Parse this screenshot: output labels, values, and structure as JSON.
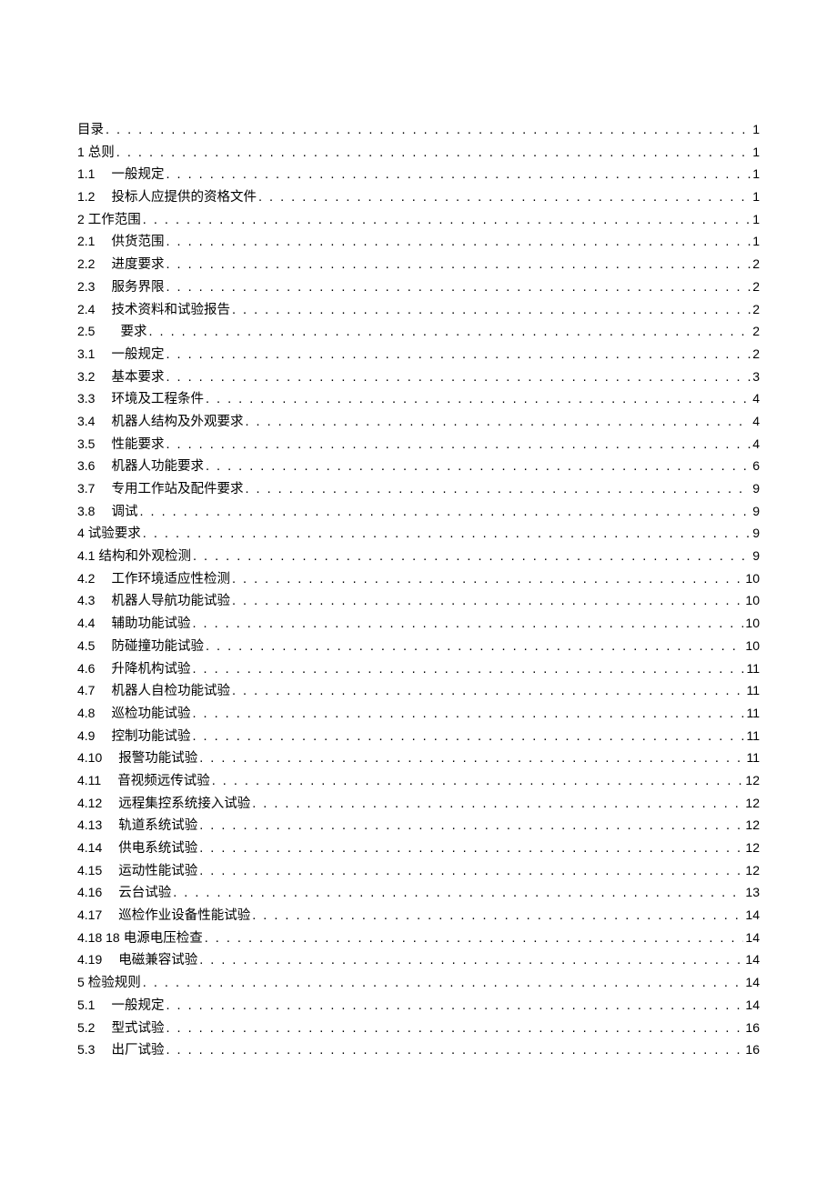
{
  "toc": [
    {
      "num": "",
      "title": "目录",
      "page": "1",
      "indent": 0
    },
    {
      "num": "1",
      "title": "总则",
      "page": "1",
      "indent": 0
    },
    {
      "num": "1.1",
      "title": "一般规定",
      "page": "1",
      "indent": 1
    },
    {
      "num": "1.2",
      "title": "投标人应提供的资格文件",
      "page": "1",
      "indent": 1
    },
    {
      "num": "2",
      "title": "工作范围",
      "page": "1",
      "indent": 0
    },
    {
      "num": "2.1",
      "title": "供货范围",
      "page": "1",
      "indent": 1
    },
    {
      "num": "2.2",
      "title": "进度要求",
      "page": "2",
      "indent": 1
    },
    {
      "num": "2.3",
      "title": "服务界限",
      "page": "2",
      "indent": 1
    },
    {
      "num": "2.4",
      "title": "技术资料和试验报告",
      "page": "2",
      "indent": 1
    },
    {
      "num": "2.5",
      "title": "要求",
      "page": "2",
      "indent": 1,
      "special": true
    },
    {
      "num": "3.1",
      "title": "一般规定",
      "page": "2",
      "indent": 1
    },
    {
      "num": "3.2",
      "title": "基本要求",
      "page": "3",
      "indent": 1
    },
    {
      "num": "3.3",
      "title": "环境及工程条件",
      "page": "4",
      "indent": 1
    },
    {
      "num": "3.4",
      "title": "机器人结构及外观要求",
      "page": "4",
      "indent": 1
    },
    {
      "num": "3.5",
      "title": "性能要求",
      "page": "4",
      "indent": 1
    },
    {
      "num": "3.6",
      "title": "机器人功能要求",
      "page": "6",
      "indent": 1
    },
    {
      "num": "3.7",
      "title": "专用工作站及配件要求",
      "page": "9",
      "indent": 1
    },
    {
      "num": "3.8",
      "title": "调试",
      "page": "9",
      "indent": 1
    },
    {
      "num": "4",
      "title": "试验要求",
      "page": "9",
      "indent": 0
    },
    {
      "num": "4.1",
      "title": "结构和外观检测",
      "page": "9",
      "indent": 0
    },
    {
      "num": "4.2",
      "title": "工作环境适应性检测",
      "page": "10",
      "indent": 1
    },
    {
      "num": "4.3",
      "title": "机器人导航功能试验",
      "page": "10",
      "indent": 1
    },
    {
      "num": "4.4",
      "title": "辅助功能试验",
      "page": "10",
      "indent": 1
    },
    {
      "num": "4.5",
      "title": "防碰撞功能试验",
      "page": "10",
      "indent": 1
    },
    {
      "num": "4.6",
      "title": "升降机构试验",
      "page": "11",
      "indent": 1
    },
    {
      "num": "4.7",
      "title": "机器人自检功能试验",
      "page": "11",
      "indent": 1
    },
    {
      "num": "4.8",
      "title": "巡检功能试验",
      "page": "11",
      "indent": 1
    },
    {
      "num": "4.9",
      "title": "控制功能试验",
      "page": "11",
      "indent": 1
    },
    {
      "num": "4.10",
      "title": "报警功能试验",
      "page": "11",
      "indent": 2
    },
    {
      "num": "4.11",
      "title": "音视频远传试验",
      "page": "12",
      "indent": 2
    },
    {
      "num": "4.12",
      "title": "远程集控系统接入试验",
      "page": "12",
      "indent": 2
    },
    {
      "num": "4.13",
      "title": "轨道系统试验",
      "page": "12",
      "indent": 2
    },
    {
      "num": "4.14",
      "title": "供电系统试验",
      "page": "12",
      "indent": 2
    },
    {
      "num": "4.15",
      "title": "运动性能试验",
      "page": "12",
      "indent": 2
    },
    {
      "num": "4.16",
      "title": "云台试验",
      "page": "13",
      "indent": 2
    },
    {
      "num": "4.17",
      "title": "巡检作业设备性能试验",
      "page": "14",
      "indent": 2
    },
    {
      "num": "4.18 18",
      "title": "电源电压检查",
      "page": "14",
      "indent": 0
    },
    {
      "num": "4.19",
      "title": "电磁兼容试验",
      "page": "14",
      "indent": 2
    },
    {
      "num": "5",
      "title": "检验规则",
      "page": "14",
      "indent": 0
    },
    {
      "num": "5.1",
      "title": "一般规定",
      "page": "14",
      "indent": 1
    },
    {
      "num": "5.2",
      "title": "型式试验",
      "page": "16",
      "indent": 1
    },
    {
      "num": "5.3",
      "title": "出厂试验",
      "page": "16",
      "indent": 1
    }
  ]
}
